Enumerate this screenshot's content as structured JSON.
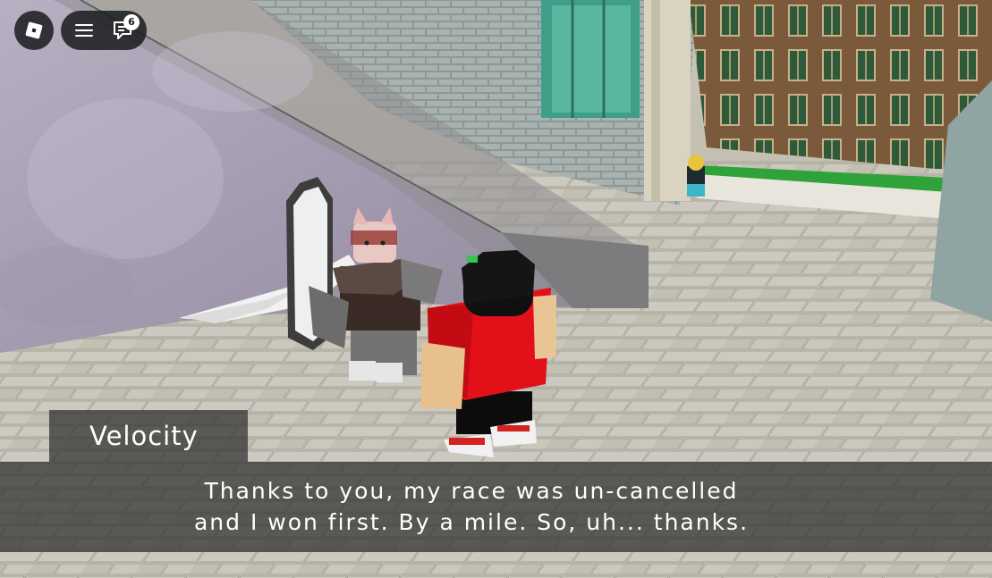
{
  "hud": {
    "roblox_button_icon": "roblox-logo-icon",
    "menu_icon": "hamburger-menu-icon",
    "chat_icon": "chat-icon",
    "chat_unread_count": "6"
  },
  "dialog": {
    "speaker": "Velocity",
    "lines": [
      "Thanks to you, my race was un-cancelled",
      "and I won first. By a mile. So, uh... thanks."
    ]
  },
  "colors": {
    "hud_background": "#191b1d",
    "dialog_background": "#2e2e2e",
    "text": "#ffffff",
    "player_shirt": "#e3101a"
  }
}
